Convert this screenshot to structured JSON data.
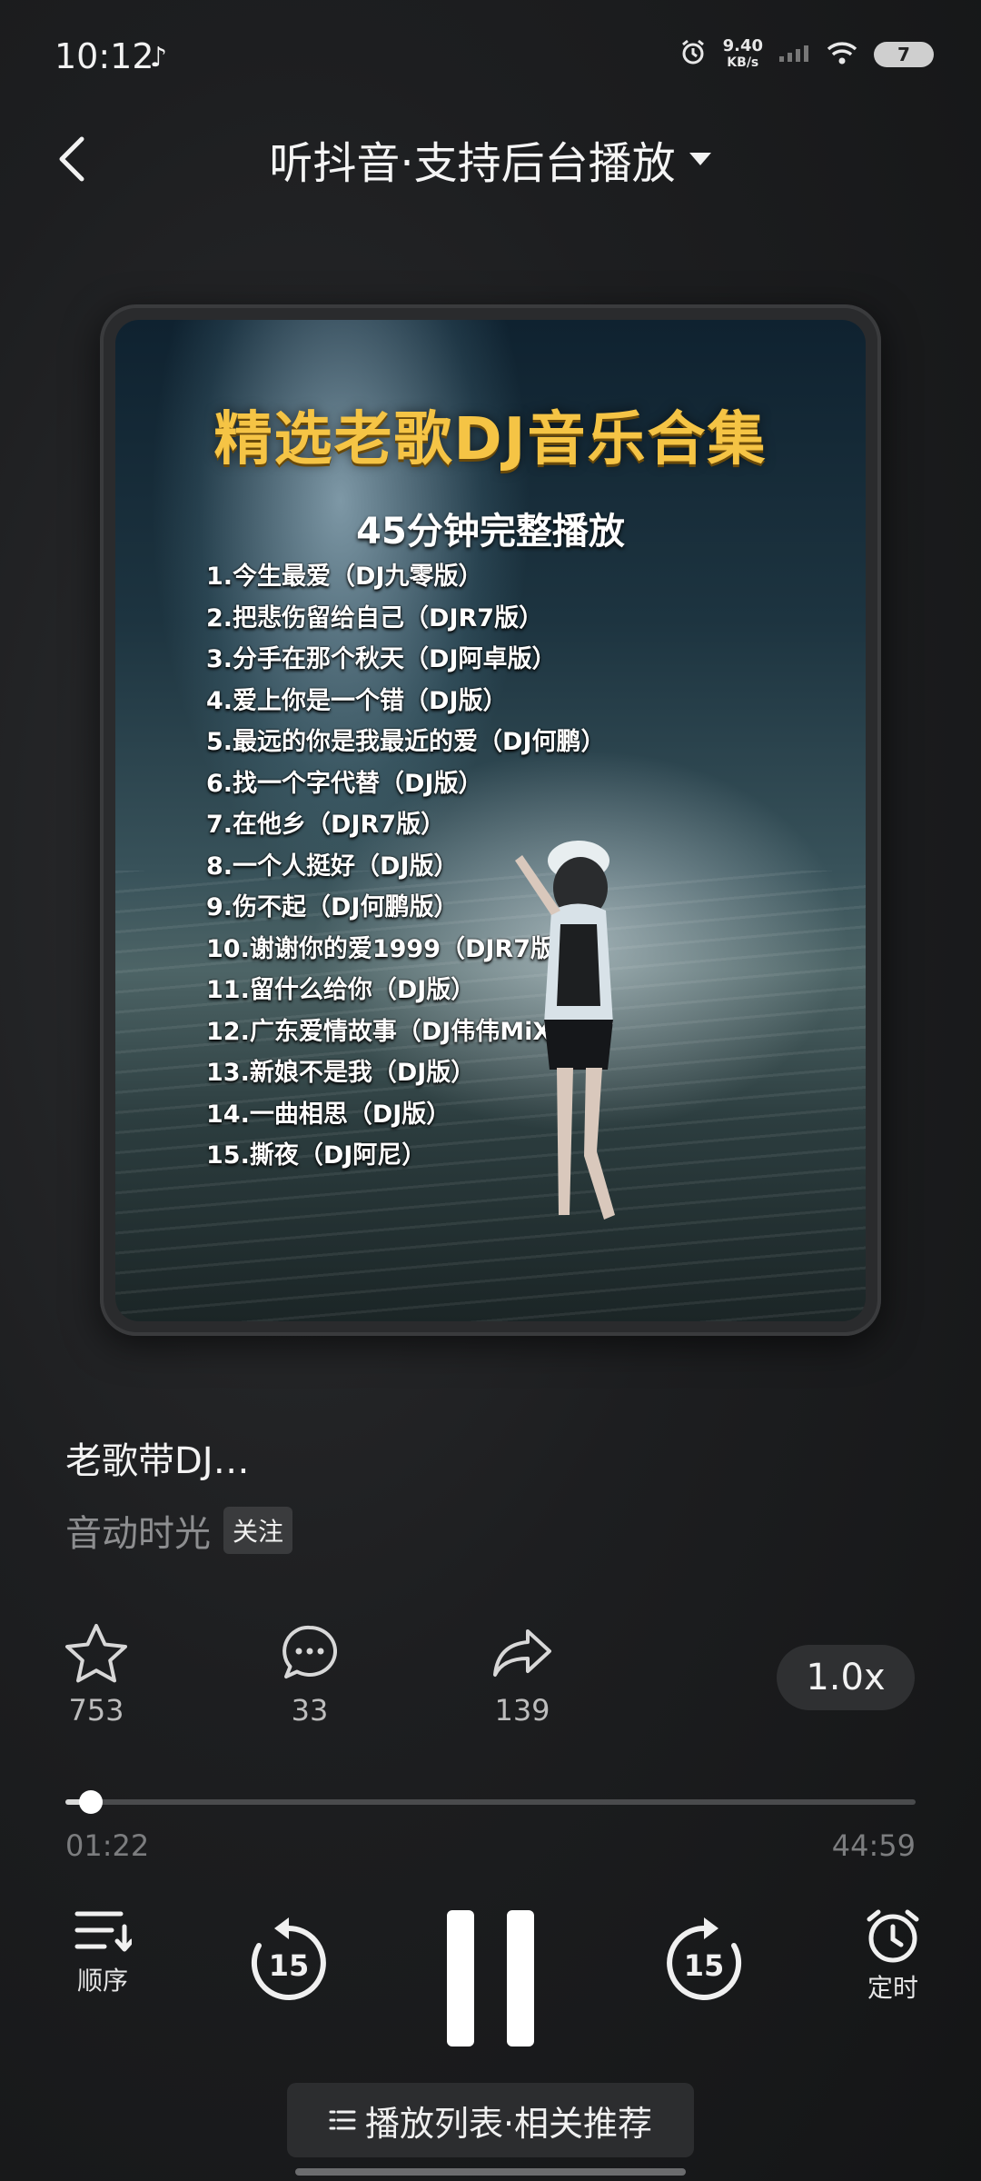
{
  "status_bar": {
    "time": "10:12",
    "net_speed_value": "9.40",
    "net_speed_unit": "KB/s",
    "battery": "7"
  },
  "header": {
    "title": "听抖音·支持后台播放"
  },
  "cover": {
    "title": "精选老歌DJ音乐合集",
    "subtitle": "45分钟完整播放",
    "tracks": [
      "1.今生最爱（DJ九零版）",
      "2.把悲伤留给自己（DJR7版）",
      "3.分手在那个秋天（DJ阿卓版）",
      "4.爱上你是一个错（DJ版）",
      "5.最远的你是我最近的爱（DJ何鹏）",
      "6.找一个字代替（DJ版）",
      "7.在他乡（DJR7版）",
      "8.一个人挺好（DJ版）",
      "9.伤不起（DJ何鹏版）",
      "10.谢谢你的爱1999（DJR7版）",
      "11.留什么给你（DJ版）",
      "12.广东爱情故事（DJ伟伟MiX）",
      "13.新娘不是我（DJ版）",
      "14.一曲相思（DJ版）",
      "15.撕夜（DJ阿尼）"
    ]
  },
  "song": {
    "title": "老歌带DJ…",
    "artist": "音动时光",
    "follow_label": "关注"
  },
  "actions": {
    "favorite_count": "753",
    "comment_count": "33",
    "share_count": "139",
    "speed": "1.0x"
  },
  "progress": {
    "current": "01:22",
    "total": "44:59",
    "fraction": 0.03
  },
  "controls": {
    "order_label": "顺序",
    "rewind_seconds": "15",
    "forward_seconds": "15",
    "timer_label": "定时"
  },
  "playlist_button": {
    "label": "播放列表·相关推荐"
  },
  "icons": {
    "back": "chevron-left-icon",
    "dropdown": "caret-down-icon",
    "favorite": "star-icon",
    "comment": "comment-icon",
    "share": "share-icon",
    "order": "list-order-icon",
    "rewind": "rewind-15-icon",
    "pause": "pause-icon",
    "forward": "forward-15-icon",
    "timer": "alarm-clock-icon",
    "playlist": "list-icon"
  }
}
